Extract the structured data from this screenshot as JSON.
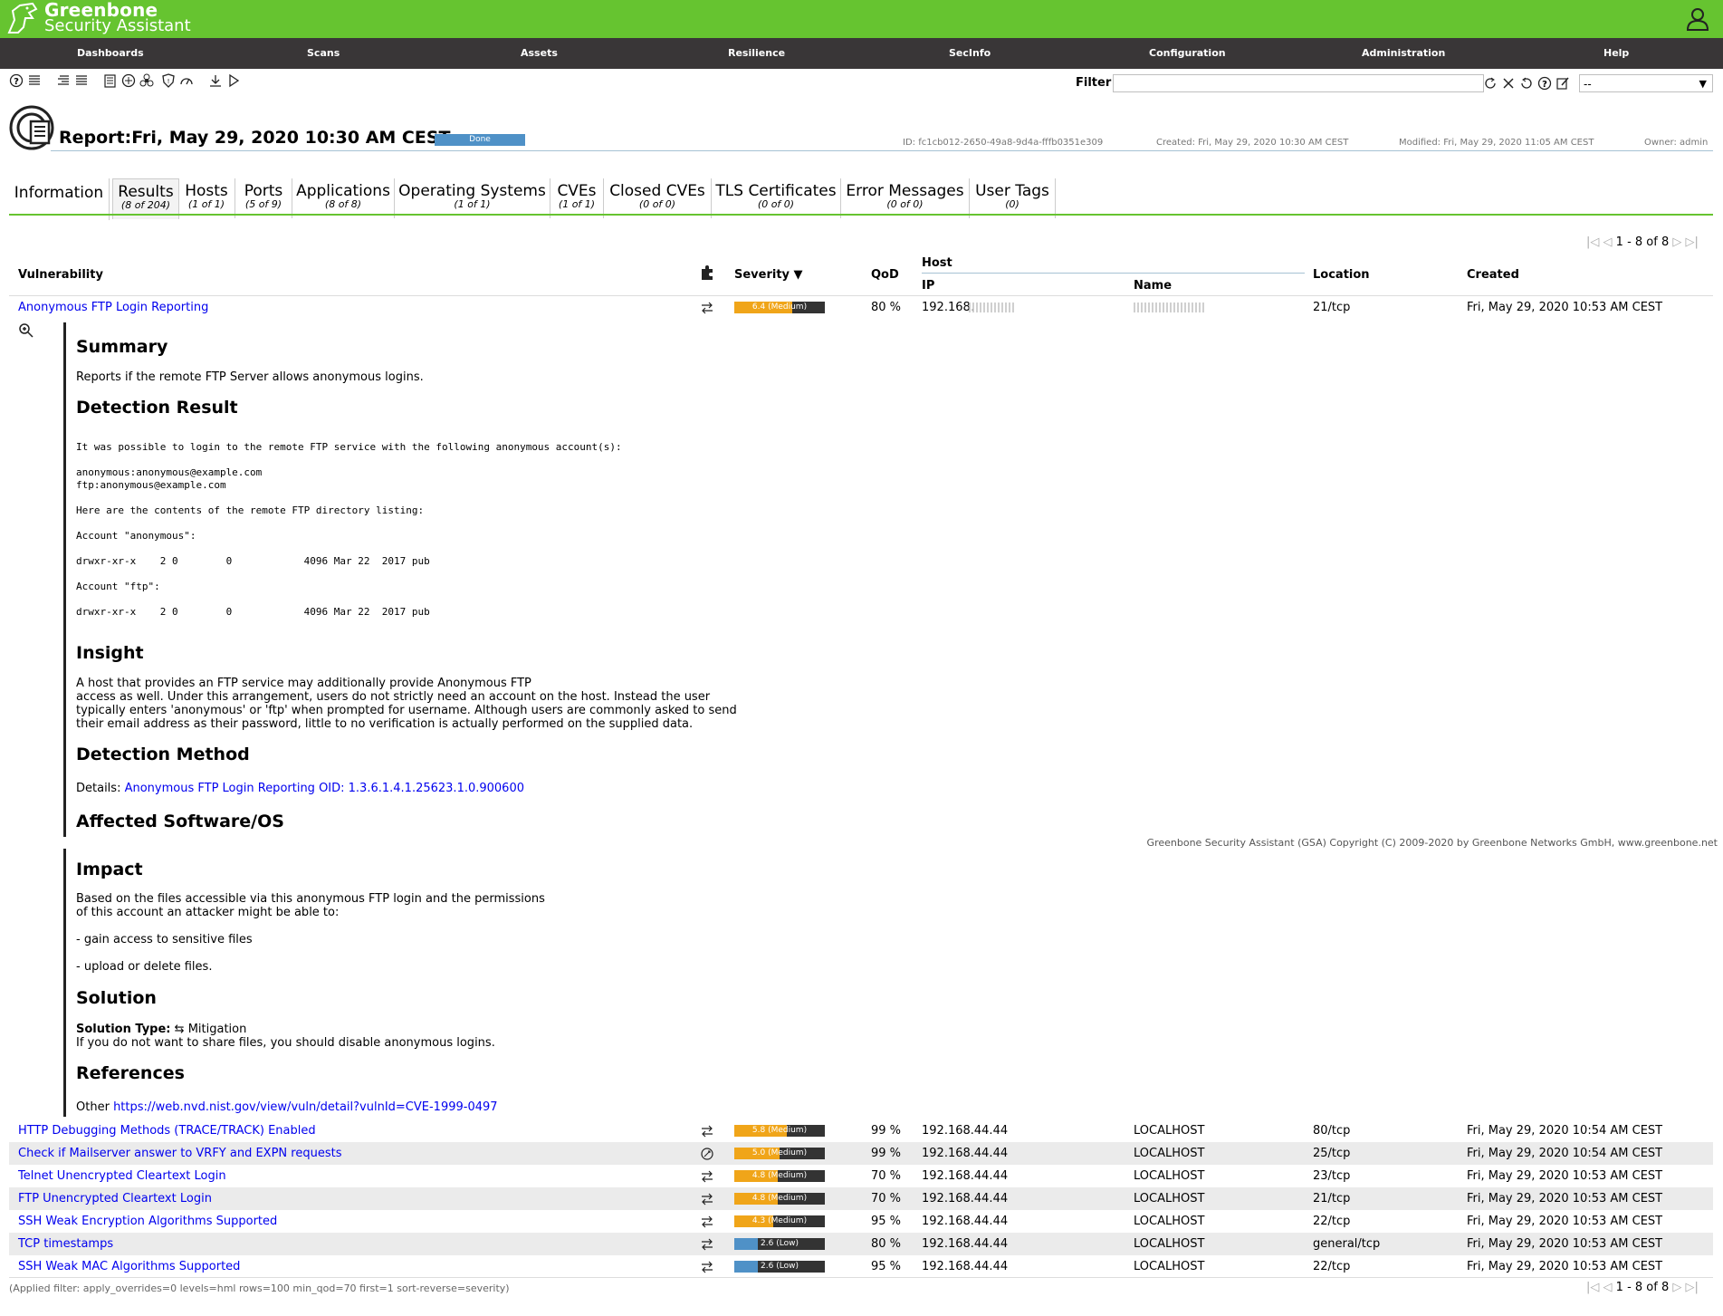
{
  "app": {
    "name_line1": "Greenbone",
    "name_line2": "Security Assistant"
  },
  "nav": [
    "Dashboards",
    "Scans",
    "Assets",
    "Resilience",
    "SecInfo",
    "Configuration",
    "Administration",
    "Help"
  ],
  "filter": {
    "label": "Filter",
    "value": "",
    "select_value": "--"
  },
  "report": {
    "title": "Report:Fri, May 29, 2020 10:30 AM CEST",
    "status": "Done",
    "id": "ID: fc1cb012-2650-49a8-9d4a-fffb0351e309",
    "created": "Created: Fri, May 29, 2020 10:30 AM CEST",
    "modified": "Modified: Fri, May 29, 2020 11:05 AM CEST",
    "owner": "Owner: admin"
  },
  "tabs": [
    {
      "label": "Information",
      "count": ""
    },
    {
      "label": "Results",
      "count": "(8 of 204)"
    },
    {
      "label": "Hosts",
      "count": "(1 of 1)"
    },
    {
      "label": "Ports",
      "count": "(5 of 9)"
    },
    {
      "label": "Applications",
      "count": "(8 of 8)"
    },
    {
      "label": "Operating Systems",
      "count": "(1 of 1)"
    },
    {
      "label": "CVEs",
      "count": "(1 of 1)"
    },
    {
      "label": "Closed CVEs",
      "count": "(0 of 0)"
    },
    {
      "label": "TLS Certificates",
      "count": "(0 of 0)"
    },
    {
      "label": "Error Messages",
      "count": "(0 of 0)"
    },
    {
      "label": "User Tags",
      "count": "(0)"
    }
  ],
  "pager": "1 - 8 of 8",
  "columns": {
    "vulnerability": "Vulnerability",
    "severity": "Severity ▼",
    "qod": "QoD",
    "host": "Host",
    "ip": "IP",
    "name": "Name",
    "location": "Location",
    "created": "Created"
  },
  "colors": {
    "medium": "#f0a519",
    "low": "#4f91c7",
    "brand": "#66c430"
  },
  "first_row": {
    "vulnerability": "Anonymous FTP Login Reporting",
    "severity": 6.4,
    "severity_text": "6.4 (Medium)",
    "qod": "80 %",
    "ip": "192.168.",
    "location": "21/tcp",
    "created": "Fri, May 29, 2020 10:53 AM CEST"
  },
  "details": {
    "summary_h": "Summary",
    "summary": "Reports if the remote FTP Server allows anonymous logins.",
    "detection_result_h": "Detection Result",
    "detection_result": "It was possible to login to the remote FTP service with the following anonymous account(s):\n\nanonymous:anonymous@example.com\nftp:anonymous@example.com\n\nHere are the contents of the remote FTP directory listing:\n\nAccount \"anonymous\":\n\ndrwxr-xr-x    2 0        0            4096 Mar 22  2017 pub\n\nAccount \"ftp\":\n\ndrwxr-xr-x    2 0        0            4096 Mar 22  2017 pub",
    "insight_h": "Insight",
    "insight": "A host that provides an FTP service may additionally provide Anonymous FTP\naccess as well. Under this arrangement, users do not strictly need an account on the host. Instead the user\ntypically enters 'anonymous' or 'ftp' when prompted for username. Although users are commonly asked to send\ntheir email address as their password, little to no verification is actually performed on the supplied data.",
    "detection_method_h": "Detection Method",
    "details_label": "Details:",
    "details_link": "Anonymous FTP Login Reporting OID: 1.3.6.1.4.1.25623.1.0.900600",
    "affected_h": "Affected Software/OS",
    "impact_h": "Impact",
    "impact": "Based on the files accessible via this anonymous FTP login and the permissions\nof this account an attacker might be able to:\n\n- gain access to sensitive files\n\n- upload or delete files.",
    "solution_h": "Solution",
    "solution_type_label": "Solution Type:",
    "solution_type": "Mitigation",
    "solution": "If you do not want to share files, you should disable anonymous logins.",
    "references_h": "References",
    "references_label": "Other",
    "references_link": "https://web.nvd.nist.gov/view/vuln/detail?vulnId=CVE-1999-0497"
  },
  "copyright": "Greenbone Security Assistant (GSA) Copyright (C) 2009-2020 by Greenbone Networks GmbH, www.greenbone.net",
  "rows": [
    {
      "vulnerability": "HTTP Debugging Methods (TRACE/TRACK) Enabled",
      "severity": 5.8,
      "severity_text": "5.8 (Medium)",
      "qod": "99 %",
      "ip": "192.168.44.44",
      "name": "LOCALHOST",
      "location": "80/tcp",
      "created": "Fri, May 29, 2020 10:54 AM CEST"
    },
    {
      "vulnerability": "Check if Mailserver answer to VRFY and EXPN requests",
      "severity": 5.0,
      "severity_text": "5.0 (Medium)",
      "qod": "99 %",
      "ip": "192.168.44.44",
      "name": "LOCALHOST",
      "location": "25/tcp",
      "created": "Fri, May 29, 2020 10:54 AM CEST"
    },
    {
      "vulnerability": "Telnet Unencrypted Cleartext Login",
      "severity": 4.8,
      "severity_text": "4.8 (Medium)",
      "qod": "70 %",
      "ip": "192.168.44.44",
      "name": "LOCALHOST",
      "location": "23/tcp",
      "created": "Fri, May 29, 2020 10:53 AM CEST"
    },
    {
      "vulnerability": "FTP Unencrypted Cleartext Login",
      "severity": 4.8,
      "severity_text": "4.8 (Medium)",
      "qod": "70 %",
      "ip": "192.168.44.44",
      "name": "LOCALHOST",
      "location": "21/tcp",
      "created": "Fri, May 29, 2020 10:53 AM CEST"
    },
    {
      "vulnerability": "SSH Weak Encryption Algorithms Supported",
      "severity": 4.3,
      "severity_text": "4.3 (Medium)",
      "qod": "95 %",
      "ip": "192.168.44.44",
      "name": "LOCALHOST",
      "location": "22/tcp",
      "created": "Fri, May 29, 2020 10:53 AM CEST"
    },
    {
      "vulnerability": "TCP timestamps",
      "severity": 2.6,
      "severity_text": "2.6 (Low)",
      "qod": "80 %",
      "ip": "192.168.44.44",
      "name": "LOCALHOST",
      "location": "general/tcp",
      "created": "Fri, May 29, 2020 10:53 AM CEST"
    },
    {
      "vulnerability": "SSH Weak MAC Algorithms Supported",
      "severity": 2.6,
      "severity_text": "2.6 (Low)",
      "qod": "95 %",
      "ip": "192.168.44.44",
      "name": "LOCALHOST",
      "location": "22/tcp",
      "created": "Fri, May 29, 2020 10:53 AM CEST"
    }
  ],
  "applied_filter": "(Applied filter: apply_overrides=0 levels=hml rows=100 min_qod=70 first=1 sort-reverse=severity)"
}
